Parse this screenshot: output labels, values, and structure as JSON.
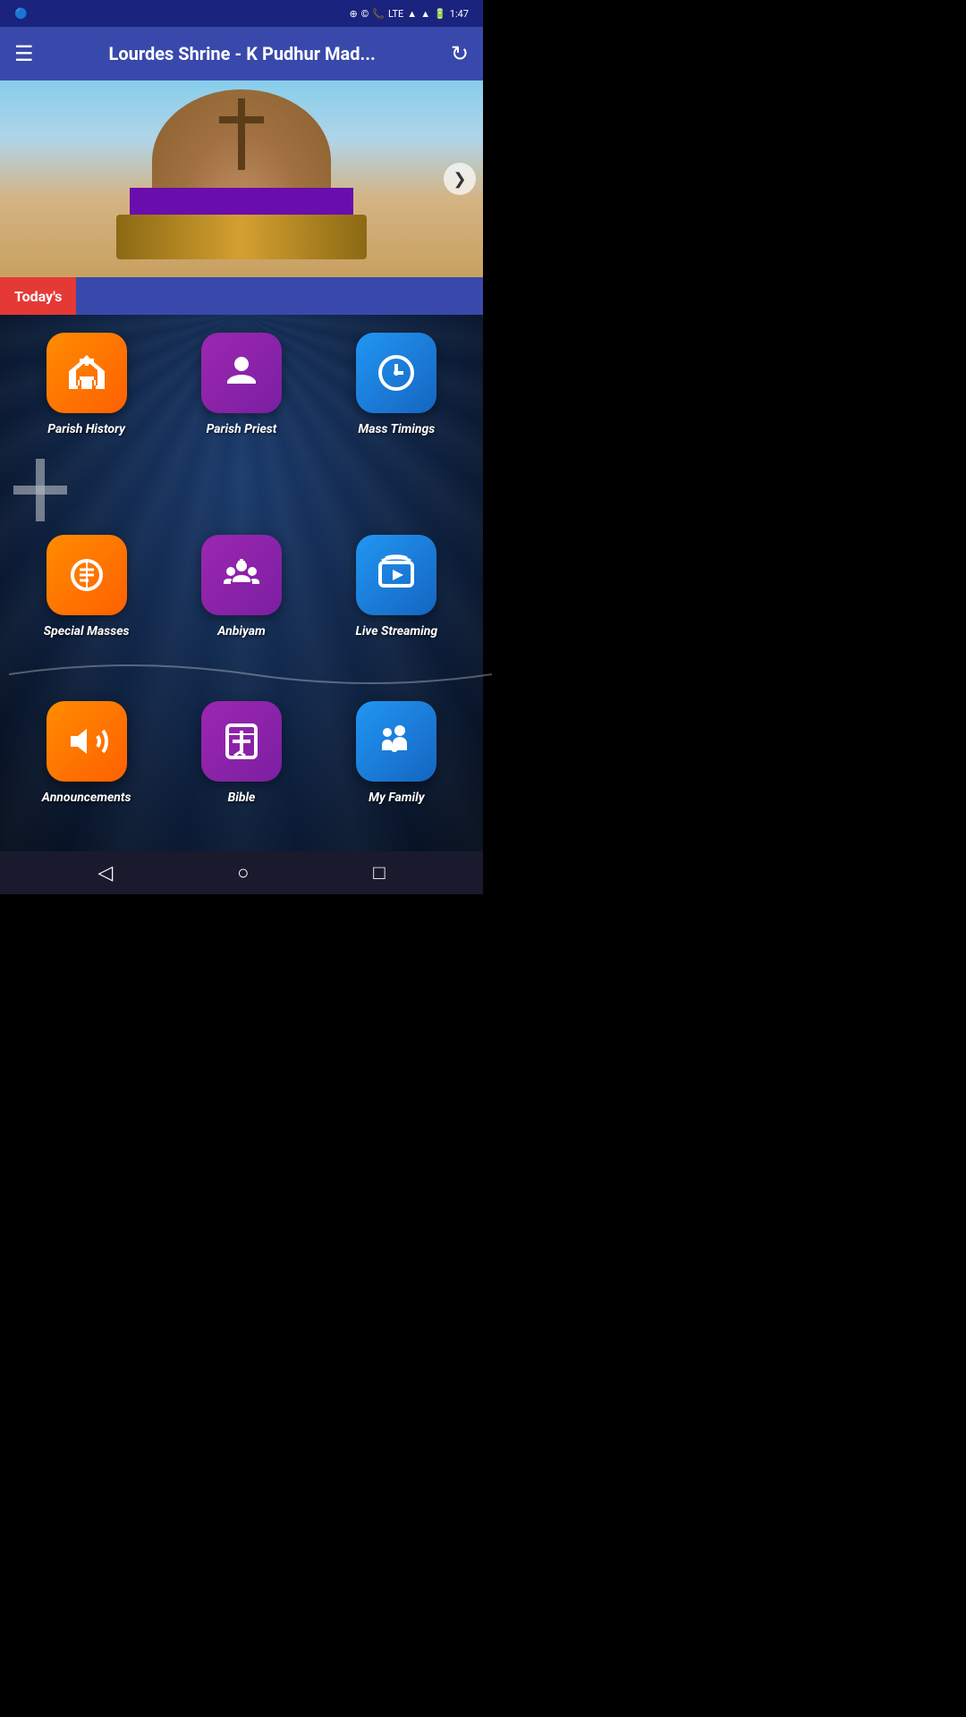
{
  "statusBar": {
    "time": "1:47",
    "lte": "LTE"
  },
  "header": {
    "title": "Lourdes Shrine - K Pudhur Mad...",
    "menuIcon": "☰",
    "refreshIcon": "↻"
  },
  "hero": {
    "nextLabel": "❯"
  },
  "todaysBanner": {
    "label": "Today's"
  },
  "grid": {
    "rows": [
      [
        {
          "id": "parish-history",
          "label": "Parish History",
          "iconType": "orange",
          "iconName": "church-icon"
        },
        {
          "id": "parish-priest",
          "label": "Parish Priest",
          "iconType": "purple",
          "iconName": "priest-icon"
        },
        {
          "id": "mass-timings",
          "label": "Mass Timings",
          "iconType": "blue",
          "iconName": "clock-icon"
        }
      ],
      [
        {
          "id": "special-masses",
          "label": "Special Masses",
          "iconType": "orange",
          "iconName": "book-icon"
        },
        {
          "id": "anbiyam",
          "label": "Anbiyam",
          "iconType": "purple",
          "iconName": "group-icon"
        },
        {
          "id": "live-streaming",
          "label": "Live Streaming",
          "iconType": "blue",
          "iconName": "stream-icon"
        }
      ],
      [
        {
          "id": "announcements",
          "label": "Announcements",
          "iconType": "orange",
          "iconName": "megaphone-icon"
        },
        {
          "id": "bible",
          "label": "Bible",
          "iconType": "purple",
          "iconName": "bible-icon"
        },
        {
          "id": "my-family",
          "label": "My Family",
          "iconType": "blue",
          "iconName": "family-icon"
        }
      ]
    ]
  },
  "navBar": {
    "backIcon": "◁",
    "homeIcon": "○",
    "squareIcon": "□"
  }
}
